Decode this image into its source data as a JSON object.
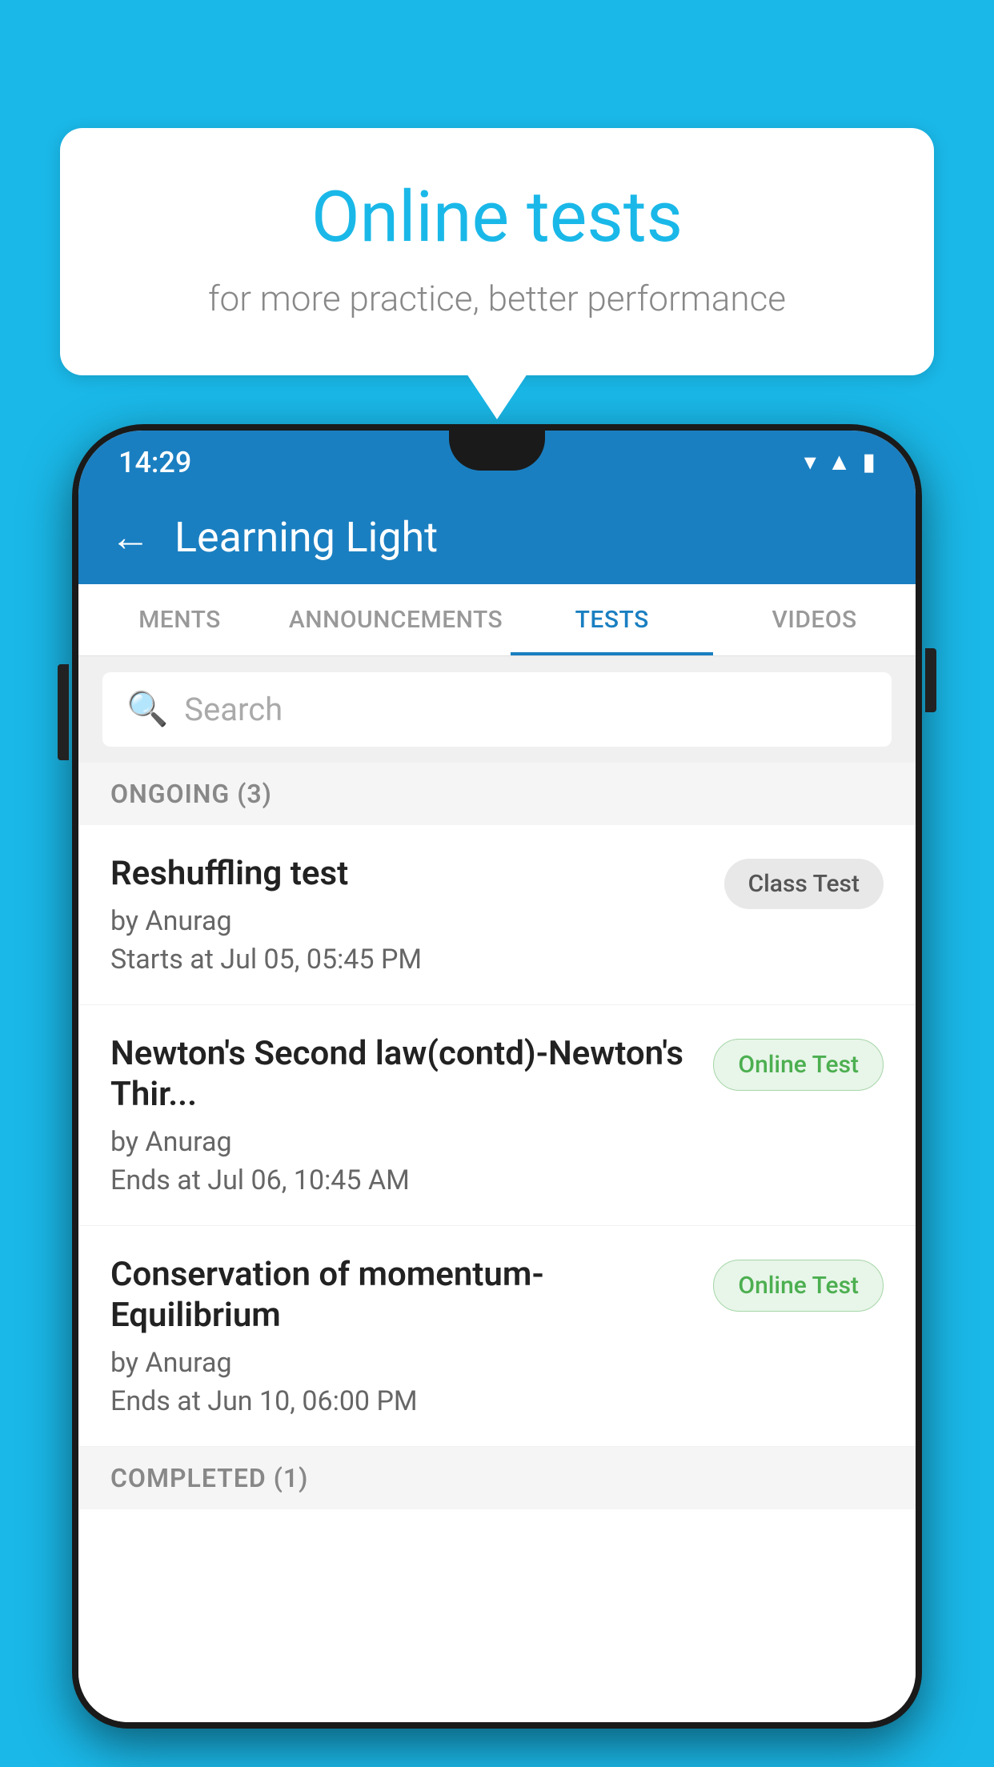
{
  "background": {
    "color": "#1ab8e8"
  },
  "bubble": {
    "title": "Online tests",
    "subtitle": "for more practice, better performance"
  },
  "phone": {
    "status_bar": {
      "time": "14:29",
      "icons": [
        "wifi",
        "signal",
        "battery"
      ]
    },
    "header": {
      "title": "Learning Light",
      "back_label": "←"
    },
    "tabs": [
      {
        "label": "MENTS",
        "active": false
      },
      {
        "label": "ANNOUNCEMENTS",
        "active": false
      },
      {
        "label": "TESTS",
        "active": true
      },
      {
        "label": "VIDEOS",
        "active": false
      }
    ],
    "search": {
      "placeholder": "Search"
    },
    "ongoing_section": {
      "label": "ONGOING (3)"
    },
    "tests": [
      {
        "name": "Reshuffling test",
        "author": "by Anurag",
        "date": "Starts at  Jul 05, 05:45 PM",
        "badge": "Class Test",
        "badge_type": "class"
      },
      {
        "name": "Newton's Second law(contd)-Newton's Thir...",
        "author": "by Anurag",
        "date": "Ends at  Jul 06, 10:45 AM",
        "badge": "Online Test",
        "badge_type": "online"
      },
      {
        "name": "Conservation of momentum-Equilibrium",
        "author": "by Anurag",
        "date": "Ends at  Jun 10, 06:00 PM",
        "badge": "Online Test",
        "badge_type": "online"
      }
    ],
    "completed_section": {
      "label": "COMPLETED (1)"
    }
  }
}
